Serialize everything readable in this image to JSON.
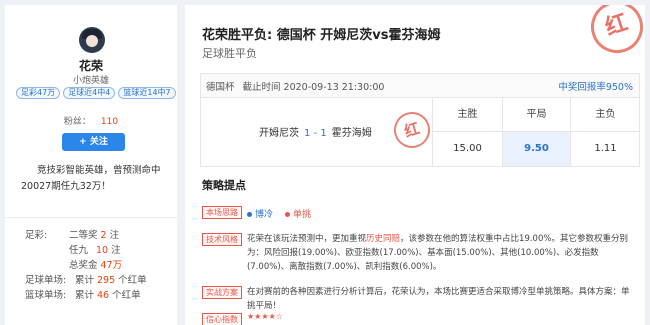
{
  "profile": {
    "name": "花荣",
    "title": "小炮英雄",
    "badges": [
      "足彩47万",
      "足球近4中4",
      "篮球近14中7"
    ],
    "fans_label": "粉丝：",
    "fans_count": "110",
    "follow_label": "+ 关注",
    "intro": "竞技彩智能英雄，曾预测命中20027期任九32万！",
    "stats": {
      "zucai_label": "足彩:",
      "erdeng_label": "二等奖",
      "erdeng_count": "2",
      "erdeng_unit": "注",
      "renjiu_label": "任九",
      "renjiu_count": "10",
      "renjiu_unit": "注",
      "total_label": "总奖金",
      "total_value": "47万",
      "football_label": "足球单场:",
      "football_prefix": "累计",
      "football_count": "295",
      "football_unit": "个红单",
      "basketball_label": "篮球单场:",
      "basketball_prefix": "累计",
      "basketball_count": "46",
      "basketball_unit": "个红单"
    }
  },
  "match": {
    "title": "花荣胜平负: 德国杯 开姆尼茨vs霍芬海姆",
    "subtitle": "足球胜平负",
    "stamp": "红",
    "league": "德国杯",
    "deadline": "截止时间 2020-09-13 21:30:00",
    "return_rate": "中奖回报率950%",
    "home": "开姆尼茨",
    "score": "1 - 1",
    "away": "霍芬海姆",
    "odds_headers": [
      "主胜",
      "平局",
      "主负"
    ],
    "odds_values": [
      "15.00",
      "9.50",
      "1.11"
    ],
    "selected_index": 1
  },
  "strategy": {
    "section_title": "策略提点",
    "tag_thinking": "本场思路",
    "option_a": "博冷",
    "option_b": "单挑",
    "tag_tech": "技术风格",
    "tech_pre": "花荣在该玩法预测中，更加重视",
    "tech_hl": "历史同赔",
    "tech_post": "，该参数在他的算法权重中占比19.00%。其它参数权重分别为：风险回报(19.00%)、欧亚指数(17.00%)、基本面(15.00%)、其他(10.00%)、必发指数(7.00%)、离散指数(7.00%)、凯利指数(6.00%)。",
    "tag_practice": "实战方案",
    "practice_text": "在对赛前的各种因素进行分析计算后，花荣认为，本场比赛更适合采取博冷型单挑策略。具体方案：单挑平局！",
    "tag_confidence": "信心指数",
    "stars": "★★★★☆",
    "accent_red": "#e8584a",
    "accent_blue": "#2a72cf"
  }
}
